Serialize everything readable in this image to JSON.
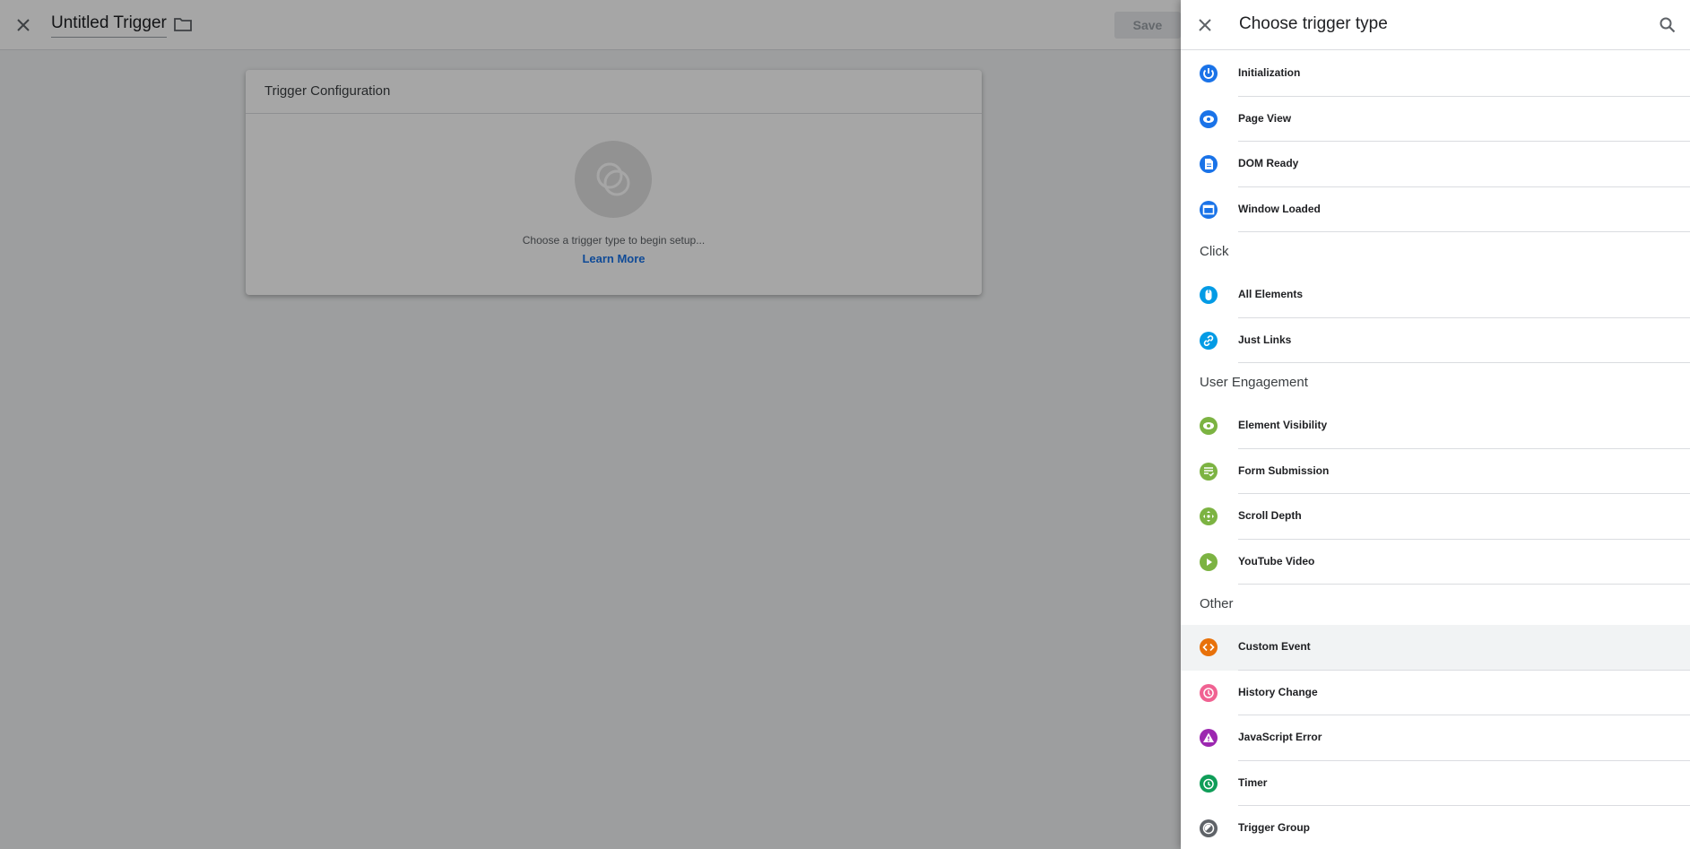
{
  "editor": {
    "title": "Untitled Trigger",
    "save_label": "Save",
    "config_title": "Trigger Configuration",
    "config_hint": "Choose a trigger type to begin setup...",
    "learn_more": "Learn More"
  },
  "panel": {
    "title": "Choose trigger type",
    "sections": [
      {
        "header": "",
        "items": [
          {
            "label": "Initialization",
            "icon": "power-icon",
            "color": "#1a73e8"
          },
          {
            "label": "Page View",
            "icon": "eye-icon",
            "color": "#1a73e8"
          },
          {
            "label": "DOM Ready",
            "icon": "document-icon",
            "color": "#1a73e8"
          },
          {
            "label": "Window Loaded",
            "icon": "window-icon",
            "color": "#1a73e8"
          }
        ]
      },
      {
        "header": "Click",
        "items": [
          {
            "label": "All Elements",
            "icon": "mouse-icon",
            "color": "#039be5"
          },
          {
            "label": "Just Links",
            "icon": "link-icon",
            "color": "#039be5"
          }
        ]
      },
      {
        "header": "User Engagement",
        "items": [
          {
            "label": "Element Visibility",
            "icon": "eye-icon",
            "color": "#7cb342"
          },
          {
            "label": "Form Submission",
            "icon": "form-icon",
            "color": "#7cb342"
          },
          {
            "label": "Scroll Depth",
            "icon": "move-icon",
            "color": "#7cb342"
          },
          {
            "label": "YouTube Video",
            "icon": "play-icon",
            "color": "#7cb342"
          }
        ]
      },
      {
        "header": "Other",
        "items": [
          {
            "label": "Custom Event",
            "icon": "code-icon",
            "color": "#e8710a",
            "highlight": true
          },
          {
            "label": "History Change",
            "icon": "history-icon",
            "color": "#f06292"
          },
          {
            "label": "JavaScript Error",
            "icon": "warning-icon",
            "color": "#9c27b0"
          },
          {
            "label": "Timer",
            "icon": "alarm-icon",
            "color": "#0f9d58"
          },
          {
            "label": "Trigger Group",
            "icon": "trigger-group-icon",
            "color": "#5f6368"
          }
        ]
      }
    ]
  }
}
